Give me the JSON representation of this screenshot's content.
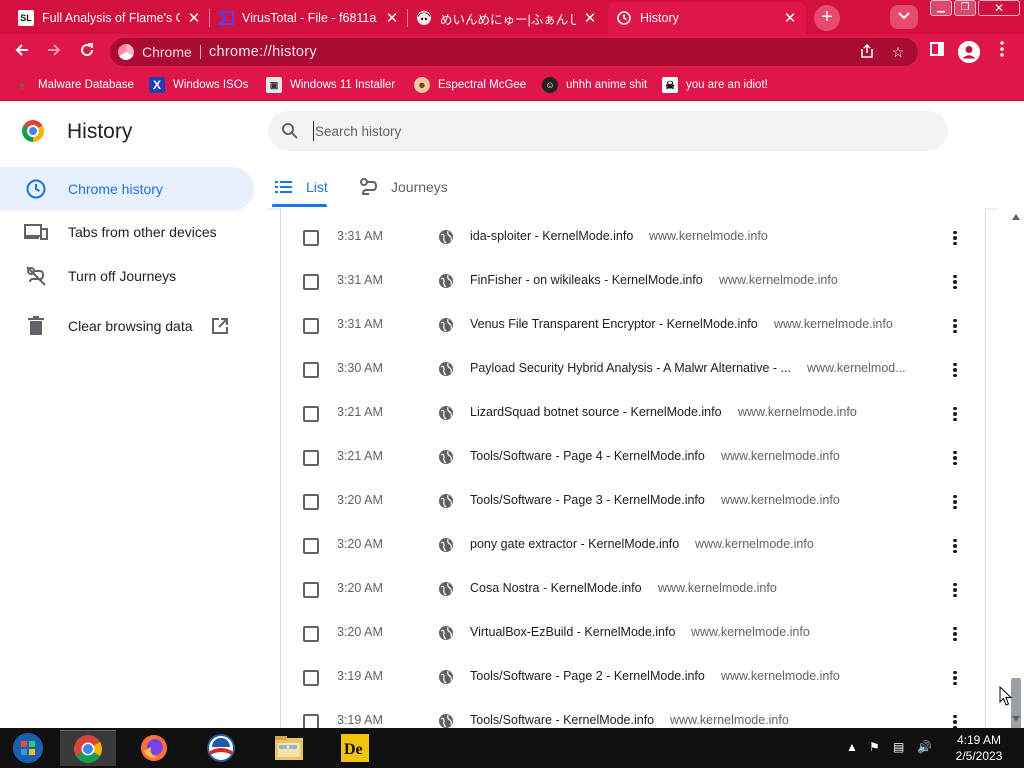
{
  "browser": {
    "tabs": [
      {
        "title": "Full Analysis of Flame's Co",
        "favicon_text": "SL",
        "active": false
      },
      {
        "title": "VirusTotal - File - f6811a",
        "favicon_text": "",
        "active": false
      },
      {
        "title": "めいんめにゅー|ふぁんしーあいれ",
        "favicon_text": "",
        "active": false
      },
      {
        "title": "History",
        "favicon_text": "",
        "active": true
      }
    ],
    "omnibox": {
      "chip": "Chrome",
      "url": "chrome://history"
    },
    "bookmarks": [
      {
        "label": "Malware Database",
        "icon": "malware-icon"
      },
      {
        "label": "Windows ISOs",
        "icon": "x-icon"
      },
      {
        "label": "Windows 11 Installer",
        "icon": "installer-icon"
      },
      {
        "label": "Espectral McGee",
        "icon": "avatar-icon"
      },
      {
        "label": "uhhh anime shit",
        "icon": "anime-icon"
      },
      {
        "label": "you are an idiot!",
        "icon": "skull-icon"
      }
    ]
  },
  "history": {
    "title": "History",
    "search_placeholder": "Search history",
    "sidebar": [
      {
        "label": "Chrome history",
        "selected": true
      },
      {
        "label": "Tabs from other devices",
        "selected": false
      },
      {
        "label": "Turn off Journeys",
        "selected": false
      },
      {
        "label": "Clear browsing data",
        "selected": false
      }
    ],
    "tabs": [
      {
        "label": "List",
        "active": true
      },
      {
        "label": "Journeys",
        "active": false
      }
    ],
    "entries": [
      {
        "time": "3:31 AM",
        "title": "ida-sploiter - KernelMode.info",
        "domain": "www.kernelmode.info"
      },
      {
        "time": "3:31 AM",
        "title": "FinFisher - on wikileaks - KernelMode.info",
        "domain": "www.kernelmode.info"
      },
      {
        "time": "3:31 AM",
        "title": "Venus File Transparent Encryptor - KernelMode.info",
        "domain": "www.kernelmode.info"
      },
      {
        "time": "3:30 AM",
        "title": "Payload Security Hybrid Analysis - A Malwr Alternative - ...",
        "domain": "www.kernelmod..."
      },
      {
        "time": "3:21 AM",
        "title": "LizardSquad botnet source - KernelMode.info",
        "domain": "www.kernelmode.info"
      },
      {
        "time": "3:21 AM",
        "title": "Tools/Software - Page 4 - KernelMode.info",
        "domain": "www.kernelmode.info"
      },
      {
        "time": "3:20 AM",
        "title": "Tools/Software - Page 3 - KernelMode.info",
        "domain": "www.kernelmode.info"
      },
      {
        "time": "3:20 AM",
        "title": "pony gate extractor - KernelMode.info",
        "domain": "www.kernelmode.info"
      },
      {
        "time": "3:20 AM",
        "title": "Cosa Nostra - KernelMode.info",
        "domain": "www.kernelmode.info"
      },
      {
        "time": "3:20 AM",
        "title": "VirtualBox-EzBuild - KernelMode.info",
        "domain": "www.kernelmode.info"
      },
      {
        "time": "3:19 AM",
        "title": "Tools/Software - Page 2 - KernelMode.info",
        "domain": "www.kernelmode.info"
      },
      {
        "time": "3:19 AM",
        "title": "Tools/Software - KernelMode.info",
        "domain": "www.kernelmode.info"
      }
    ]
  },
  "taskbar": {
    "apps": [
      "start-orb-icon",
      "chrome-icon",
      "firefox-icon",
      "obama-icon",
      "file-explorer-icon",
      "de-app-icon"
    ],
    "tray_icons": [
      "show-hidden-icons",
      "flag-icon",
      "network-icon",
      "volume-icon"
    ],
    "time": "4:19 AM",
    "date": "2/5/2023"
  },
  "colors": {
    "theme": "#e0164a",
    "tab_strip": "#d2113f",
    "accent": "#1a73e8",
    "selected_bg": "#e8f0fe"
  }
}
